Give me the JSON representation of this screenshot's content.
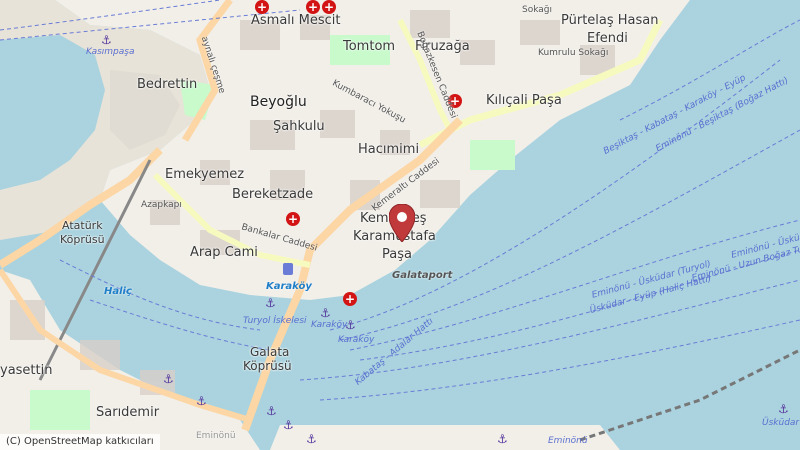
{
  "map": {
    "districts": {
      "asmali_mescit": "Asmalı Mescit",
      "tomtom": "Tomtom",
      "firuzaga": "Firuzağa",
      "purtelas": "Pürtelaş Hasan",
      "efendi": "Efendi",
      "bedrettin": "Bedrettin",
      "beyoglu": "Beyoğlu",
      "sahkulu": "Şahkulu",
      "kilicali": "Kılıçali Paşa",
      "hacimimi": "Hacımimi",
      "emekyemez": "Emekyemez",
      "bereketzade": "Bereketzade",
      "kemankes": "Kemankeş",
      "karamustafa": "Karamustafa",
      "pasa": "Paşa",
      "arap_cami": "Arap Cami",
      "ataturk": "Atatürk",
      "koprusu": "Köprüsü",
      "galata": "Galata",
      "galata_koprusu": "Köprüsü",
      "yasettin": "yasettin",
      "saridemir": "Sarıdemir",
      "azapkapi": "Azapkapı"
    },
    "streets": {
      "bogazkesen": "Boğazkesen Caddesi",
      "kemeralti": "Kemeraltı Caddesi",
      "bankalar": "Bankalar Caddesi",
      "kumbaraci": "Kumbaracı Yokuşu",
      "kumrulu": "Kumrulu Sokağı",
      "sokagi": "Sokağı",
      "aynali": "aynalı çeşme",
      "eminonu": "Eminönü"
    },
    "places": {
      "galataport": "Galataport",
      "karakoy": "Karaköy",
      "turyol": "Turyol İskelesi",
      "karakoy_pier1": "Karaköy",
      "karakoy_pier2": "Karaköy",
      "halic": "Haliç",
      "kasimpasa": "Kasımpaşa"
    },
    "ferry_routes": {
      "besiktas": "Beşiktaş - Kabataş - Karaköy - Eyüp",
      "eminonu_besiktas": "Eminönü - Beşiktaş (Boğaz Hattı)",
      "eminonu_uskudar": "Eminönü - Üsküdar (Turyol)",
      "uskudar_eyup": "Üsküdar - Eyüp (Haliç Hattı)",
      "eminonu_uzun": "Eminönü - Uzun Boğaz Turu",
      "kabatas_adalar": "Kabataş - Adalar Hattı",
      "eminonu_uskudar_right": "Eminönü - Üsküdar",
      "uskudar_right": "Üsküdar",
      "eminonu2": "Eminönü"
    },
    "attribution": "(C) OpenStreetMap katkıcıları",
    "colors": {
      "water": "#aad3df",
      "land": "#f2efe9",
      "primary_road": "#fcd6a4",
      "secondary_road": "#f7fabf",
      "hospital": "#d21414",
      "marker": "#c0393b"
    }
  }
}
